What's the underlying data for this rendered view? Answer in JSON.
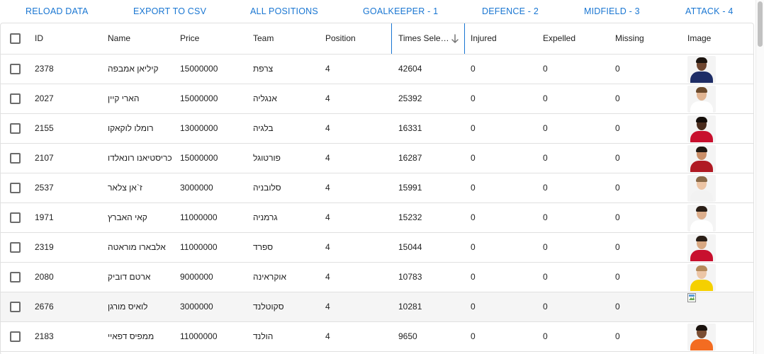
{
  "toolbar": {
    "reload": "Reload data",
    "export": "Export to CSV",
    "all_positions": "All positions",
    "goalkeeper": "Goalkeeper - 1",
    "defence": "Defence - 2",
    "midfield": "Midfield - 3",
    "attack": "Attack - 4"
  },
  "columns": {
    "id": "ID",
    "name": "Name",
    "price": "Price",
    "team": "Team",
    "position": "Position",
    "times_selected": "Times Sele…",
    "injured": "Injured",
    "expelled": "Expelled",
    "missing": "Missing",
    "image": "Image"
  },
  "sort": {
    "column": "times_selected",
    "direction": "descending",
    "icon": "arrow-down-icon"
  },
  "rows": [
    {
      "id": "2378",
      "name": "קיליאן אמבפה",
      "price": "15000000",
      "team": "צרפת",
      "position": "4",
      "times_selected": "42604",
      "injured": "0",
      "expelled": "0",
      "missing": "0",
      "image": {
        "skin": "#6e4630",
        "hair": "#1c140f",
        "shirt": "#1e2d66"
      }
    },
    {
      "id": "2027",
      "name": "הארי קיין",
      "price": "15000000",
      "team": "אנגליה",
      "position": "4",
      "times_selected": "25392",
      "injured": "0",
      "expelled": "0",
      "missing": "0",
      "image": {
        "skin": "#e0b492",
        "hair": "#6b4a2c",
        "shirt": "#ffffff"
      }
    },
    {
      "id": "2155",
      "name": "רומלו לוקאקו",
      "price": "13000000",
      "team": "בלגיה",
      "position": "4",
      "times_selected": "16331",
      "injured": "0",
      "expelled": "0",
      "missing": "0",
      "image": {
        "skin": "#4a2c1d",
        "hair": "#140d09",
        "shirt": "#c8102e"
      }
    },
    {
      "id": "2107",
      "name": "כריסטיאנו רונאלדו",
      "price": "15000000",
      "team": "פורטוגל",
      "position": "4",
      "times_selected": "16287",
      "injured": "0",
      "expelled": "0",
      "missing": "0",
      "image": {
        "skin": "#c98e68",
        "hair": "#201812",
        "shirt": "#b01a24"
      }
    },
    {
      "id": "2537",
      "name": "ז`אן צלאר",
      "price": "3000000",
      "team": "סלובניה",
      "position": "4",
      "times_selected": "15991",
      "injured": "0",
      "expelled": "0",
      "missing": "0",
      "image": {
        "skin": "#ecc4a4",
        "hair": "#8a6a48",
        "shirt": "#f2f2f2"
      }
    },
    {
      "id": "1971",
      "name": "קאי האברץ",
      "price": "11000000",
      "team": "גרמניה",
      "position": "4",
      "times_selected": "15232",
      "injured": "0",
      "expelled": "0",
      "missing": "0",
      "image": {
        "skin": "#dcae8c",
        "hair": "#2a1e16",
        "shirt": "#ffffff"
      }
    },
    {
      "id": "2319",
      "name": "אלבארו מוראטה",
      "price": "11000000",
      "team": "ספרד",
      "position": "4",
      "times_selected": "15044",
      "injured": "0",
      "expelled": "0",
      "missing": "0",
      "image": {
        "skin": "#d8a882",
        "hair": "#2a1e16",
        "shirt": "#c8102e"
      }
    },
    {
      "id": "2080",
      "name": "ארטם דוביק",
      "price": "9000000",
      "team": "אוקראינה",
      "position": "4",
      "times_selected": "10783",
      "injured": "0",
      "expelled": "0",
      "missing": "0",
      "image": {
        "skin": "#ecc6a6",
        "hair": "#b58a5a",
        "shirt": "#f5d000"
      }
    },
    {
      "id": "2676",
      "name": "לואיס מורגן",
      "price": "3000000",
      "team": "סקוטלנד",
      "position": "4",
      "times_selected": "10281",
      "injured": "0",
      "expelled": "0",
      "missing": "0",
      "image": null
    },
    {
      "id": "2183",
      "name": "ממפיס דפאיי",
      "price": "11000000",
      "team": "הולנד",
      "position": "4",
      "times_selected": "9650",
      "injured": "0",
      "expelled": "0",
      "missing": "0",
      "image": {
        "skin": "#7a4e33",
        "hair": "#1a120d",
        "shirt": "#f36c21"
      }
    }
  ],
  "highlighted_row_index": 8
}
